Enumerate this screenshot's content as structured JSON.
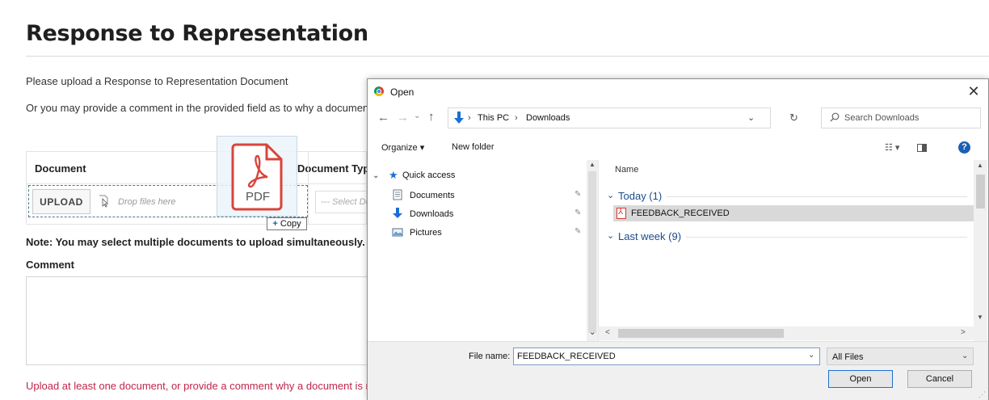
{
  "page": {
    "title": "Response to Representation",
    "intro_line1": "Please upload a Response to Representation Document",
    "intro_line2": "Or you may provide a comment in the provided field as to why a document is not being uploaded.",
    "table": {
      "col_document": "Document",
      "col_type": "Document Type",
      "upload_label": "UPLOAD",
      "drop_text": "Drop files here",
      "select_placeholder": "--- Select Document Type ---"
    },
    "note": "Note: You may select multiple documents to upload simultaneously.",
    "comment_label": "Comment",
    "error": "Upload at least one document, or provide a comment why a document is not being uploaded."
  },
  "drag": {
    "file_label": "PDF",
    "copy_label": "Copy",
    "copy_plus": "+"
  },
  "dialog": {
    "title": "Open",
    "close": "✕",
    "nav": {
      "back": "←",
      "forward": "→",
      "recent": "⌄",
      "up": "↑",
      "refresh": "↻"
    },
    "address": {
      "sep": "›",
      "this_pc": "This PC",
      "downloads": "Downloads",
      "dropdown": "⌄"
    },
    "search": {
      "placeholder": "Search Downloads"
    },
    "toolbar": {
      "organize": "Organize ▾",
      "new_folder": "New folder",
      "view": "☷ ▾",
      "help": "?"
    },
    "nav_pane": {
      "quick_access": "Quick access",
      "items": [
        {
          "label": "Documents",
          "icon": "documents-icon"
        },
        {
          "label": "Downloads",
          "icon": "downloads-icon"
        },
        {
          "label": "Pictures",
          "icon": "pictures-icon"
        }
      ],
      "pin": "📌"
    },
    "file_list": {
      "col_name": "Name",
      "groups": [
        {
          "label": "Today (1)"
        },
        {
          "label": "Last week (9)"
        }
      ],
      "files": [
        {
          "name": "FEEDBACK_RECEIVED",
          "icon": "pdf-file-icon"
        }
      ]
    },
    "footer": {
      "file_name_label": "File name:",
      "file_name_value": "FEEDBACK_RECEIVED",
      "file_type": "All Files",
      "open": "Open",
      "cancel": "Cancel"
    }
  }
}
